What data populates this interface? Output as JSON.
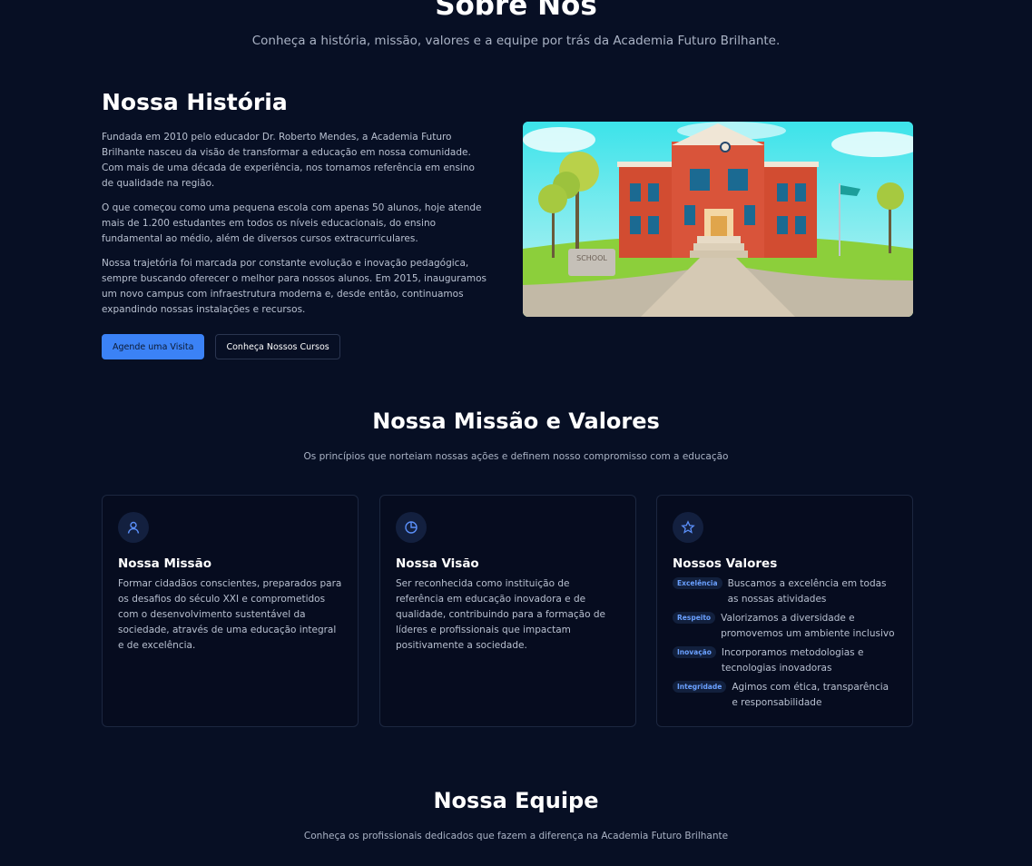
{
  "hero": {
    "title": "Sobre Nós",
    "subtitle": "Conheça a história, missão, valores e a equipe por trás da Academia Futuro Brilhante."
  },
  "history": {
    "title": "Nossa História",
    "paragraphs": [
      "Fundada em 2010 pelo educador Dr. Roberto Mendes, a Academia Futuro Brilhante nasceu da visão de transformar a educação em nossa comunidade. Com mais de uma década de experiência, nos tornamos referência em ensino de qualidade na região.",
      "O que começou como uma pequena escola com apenas 50 alunos, hoje atende mais de 1.200 estudantes em todos os níveis educacionais, do ensino fundamental ao médio, além de diversos cursos extracurriculares.",
      "Nossa trajetória foi marcada por constante evolução e inovação pedagógica, sempre buscando oferecer o melhor para nossos alunos. Em 2015, inauguramos um novo campus com infraestrutura moderna e, desde então, continuamos expandindo nossas instalações e recursos."
    ],
    "primary_button": "Agende uma Visita",
    "secondary_button": "Conheça Nossos Cursos",
    "image_sign": "SCHOOL"
  },
  "mission": {
    "title": "Nossa Missão e Valores",
    "subtitle": "Os princípios que norteiam nossas ações e definem nosso compromisso com a educação",
    "cards": [
      {
        "icon": "user-icon",
        "title": "Nossa Missão",
        "body": "Formar cidadãos conscientes, preparados para os desafios do século XXI e comprometidos com o desenvolvimento sustentável da sociedade, através de uma educação integral e de excelência."
      },
      {
        "icon": "pie-chart-icon",
        "title": "Nossa Visão",
        "body": "Ser reconhecida como instituição de referência em educação inovadora e de qualidade, contribuindo para a formação de líderes e profissionais que impactam positivamente a sociedade."
      },
      {
        "icon": "star-icon",
        "title": "Nossos Valores",
        "values": [
          {
            "badge": "Excelência",
            "text": "Buscamos a excelência em todas as nossas atividades"
          },
          {
            "badge": "Respeito",
            "text": "Valorizamos a diversidade e promovemos um ambiente inclusivo"
          },
          {
            "badge": "Inovação",
            "text": "Incorporamos metodologias e tecnologias inovadoras"
          },
          {
            "badge": "Integridade",
            "text": "Agimos com ética, transparência e responsabilidade"
          }
        ]
      }
    ]
  },
  "team": {
    "title": "Nossa Equipe",
    "subtitle": "Conheça os profissionais dedicados que fazem a diferença na Academia Futuro Brilhante"
  },
  "colors": {
    "background": "#070f24",
    "accent": "#3b82f6",
    "card_border": "#1c2740"
  }
}
